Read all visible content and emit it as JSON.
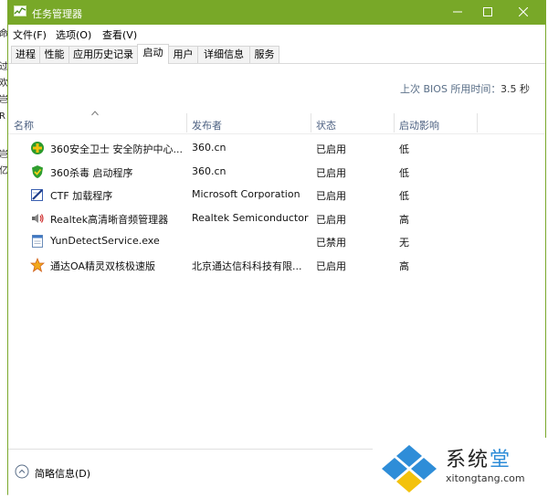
{
  "window": {
    "title": "任务管理器"
  },
  "menu": [
    "文件(F)",
    "选项(O)",
    "查看(V)"
  ],
  "tabs": [
    "进程",
    "性能",
    "应用历史记录",
    "启动",
    "用户",
    "详细信息",
    "服务"
  ],
  "active_tab": "启动",
  "bios": {
    "label": "上次 BIOS 所用时间：",
    "value": "3.5 秒"
  },
  "columns": {
    "name": "名称",
    "publisher": "发布者",
    "status": "状态",
    "impact": "启动影响"
  },
  "rows": [
    {
      "icon": "360-safe-icon",
      "name": "360安全卫士 安全防护中心...",
      "publisher": "360.cn",
      "status": "已启用",
      "impact": "低"
    },
    {
      "icon": "360-antivirus-icon",
      "name": "360杀毒 启动程序",
      "publisher": "360.cn",
      "status": "已启用",
      "impact": "低"
    },
    {
      "icon": "ctf-loader-icon",
      "name": "CTF 加载程序",
      "publisher": "Microsoft Corporation",
      "status": "已启用",
      "impact": "低"
    },
    {
      "icon": "speaker-icon",
      "name": "Realtek高清晰音频管理器",
      "publisher": "Realtek Semiconductor",
      "status": "已启用",
      "impact": "高"
    },
    {
      "icon": "document-icon",
      "name": "YunDetectService.exe",
      "publisher": "",
      "status": "已禁用",
      "impact": "无"
    },
    {
      "icon": "star-icon",
      "name": "通达OA精灵双核极速版",
      "publisher": "北京通达信科科技有限...",
      "status": "已启用",
      "impact": "高"
    }
  ],
  "footer": {
    "fewer_details": "简略信息(D)"
  },
  "watermark": {
    "title_black": "系统",
    "title_blue": "堂",
    "site": "xitongtang.com"
  },
  "background_text": [
    "命",
    "过",
    "欢",
    "岂",
    "R",
    "岂",
    "亿"
  ],
  "colors": {
    "titlebar": "#78a828",
    "header_text": "#4d6182",
    "watermark_blue": "#2e8dd8"
  }
}
